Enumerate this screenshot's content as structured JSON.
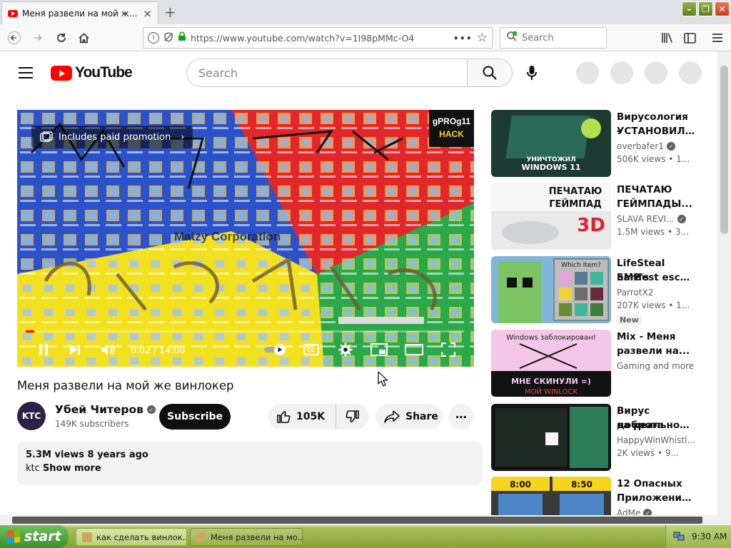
{
  "browser": {
    "tab": {
      "title": "Меня развели на мой же винлокер",
      "close": "×"
    },
    "new_tab": "+",
    "window_buttons": {
      "minimize": "–",
      "maximize": "❐",
      "close": "✕"
    },
    "url": "https://www.youtube.com/watch?v=1I98pMMc-O4",
    "search_placeholder": "Search"
  },
  "youtube": {
    "logo_text": "YouTube",
    "search_placeholder": "Search"
  },
  "player": {
    "paid_promotion": "Includes paid promotion",
    "badge_line1": "gPROg11",
    "badge_line2": "HACK",
    "time_current": "0:02",
    "time_total": "14:00",
    "time_display": "0:02 / 14:00",
    "progress_fraction": 0.0024
  },
  "video": {
    "title": "Меня развели на мой же винлокер",
    "channel_avatar_text": "KTC",
    "channel_name": "Убей Читеров",
    "subscribers": "149K subscribers",
    "subscribe_label": "Subscribe",
    "likes": "105K",
    "share_label": "Share",
    "description_meta": "5.3M views  8 years ago",
    "description_text": "ktc",
    "show_more": "Show more"
  },
  "recommendations": [
    {
      "title": "Вирусология - УСТАНОВИЛ ...",
      "title_l1": "Вирусология -",
      "title_l2": "УСТАНОВИЛ ...",
      "channel": "overbafer1",
      "verified": true,
      "views": "506K views  • 1...",
      "thumb_text": "УНИЧТОЖИЛ WINDOWS 11"
    },
    {
      "title": "ПЕЧАТАЮ ГЕЙМПАДЫ...",
      "title_l1": "ПЕЧАТАЮ",
      "title_l2": "ГЕЙМПАДЫ...",
      "channel": "SLAVA REVI...",
      "verified": true,
      "views": "1.5M views  • 3...",
      "thumb_text": "ПЕЧАТАЮ ГЕЙМПАД 3D"
    },
    {
      "title": "LifeSteal SMP's hardest escap...",
      "title_l1": "LifeSteal SMP's",
      "title_l2": "hardest escap...",
      "channel": "ParrotX2",
      "verified": false,
      "views": "207K views  • 1...",
      "badge": "New",
      "thumb_text": "Which Item?"
    },
    {
      "title": "Mix - Меня развели на...",
      "title_l1": "Mix - Меня",
      "title_l2": "развели на...",
      "channel": "Gaming and more",
      "verified": false,
      "views": "",
      "thumb_text": "Windows заблокирован! МНЕ СКИНУЛИ =) МОЙ WINLOCK"
    },
    {
      "title": "Вирус доброта на реальном...",
      "title_l1": "Вирус доброта",
      "title_l2": "на реальном...",
      "channel": "HappyWinWhistl...",
      "verified": false,
      "views": "2K views  • 9...",
      "thumb_text": ""
    },
    {
      "title": "12 Опасных Приложений...",
      "title_l1": "12 Опасных",
      "title_l2": "Приложений...",
      "channel": "AdMe",
      "verified": true,
      "views": "",
      "thumb_text": "8:00 8:50"
    }
  ],
  "taskbar": {
    "start_label": "start",
    "tasks": [
      {
        "label": "как сделать винлок..."
      },
      {
        "label": "Меня развели на мо..."
      }
    ],
    "clock": "9:30 AM"
  },
  "colors": {
    "youtube_red": "#ff0000",
    "xp_taskbar": "#97af45",
    "xp_start": "#3b8f2a"
  }
}
